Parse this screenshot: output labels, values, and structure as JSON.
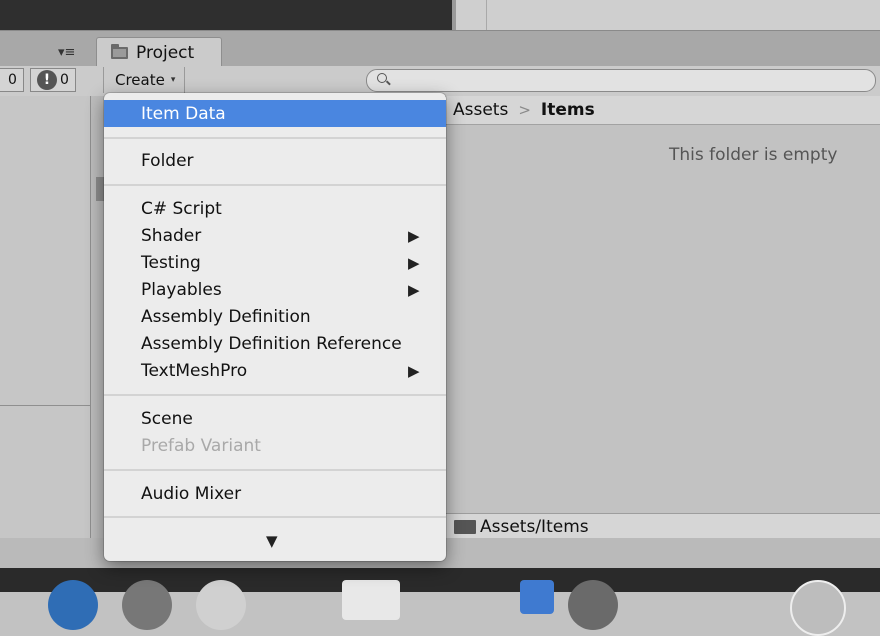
{
  "counters": {
    "first_count": "0",
    "warning_count": "0",
    "warning_icon": "!"
  },
  "tab": {
    "label": "Project",
    "icon": "folder-icon"
  },
  "toolbar": {
    "create_label": "Create",
    "create_caret": "▾",
    "search_placeholder": "",
    "tab_menu_glyph": "▾≡"
  },
  "breadcrumb": {
    "root": "Assets",
    "separator": ">",
    "current": "Items"
  },
  "content": {
    "empty_message": "This folder is empty"
  },
  "path_bar": {
    "path": "Assets/Items"
  },
  "menu": {
    "items": [
      {
        "label": "Item Data",
        "selected": true
      },
      {
        "label": "Folder"
      },
      {
        "label": "C# Script"
      },
      {
        "label": "Shader",
        "submenu": "▶"
      },
      {
        "label": "Testing",
        "submenu": "▶"
      },
      {
        "label": "Playables",
        "submenu": "▶"
      },
      {
        "label": "Assembly Definition"
      },
      {
        "label": "Assembly Definition Reference"
      },
      {
        "label": "TextMeshPro",
        "submenu": "▶"
      },
      {
        "label": "Scene"
      },
      {
        "label": "Prefab Variant",
        "disabled": true
      },
      {
        "label": "Audio Mixer"
      }
    ],
    "scroll_down": "▼"
  },
  "colors": {
    "selection": "#4a86e0",
    "menu_bg": "#ececec",
    "panel_bg": "#c2c2c2"
  }
}
